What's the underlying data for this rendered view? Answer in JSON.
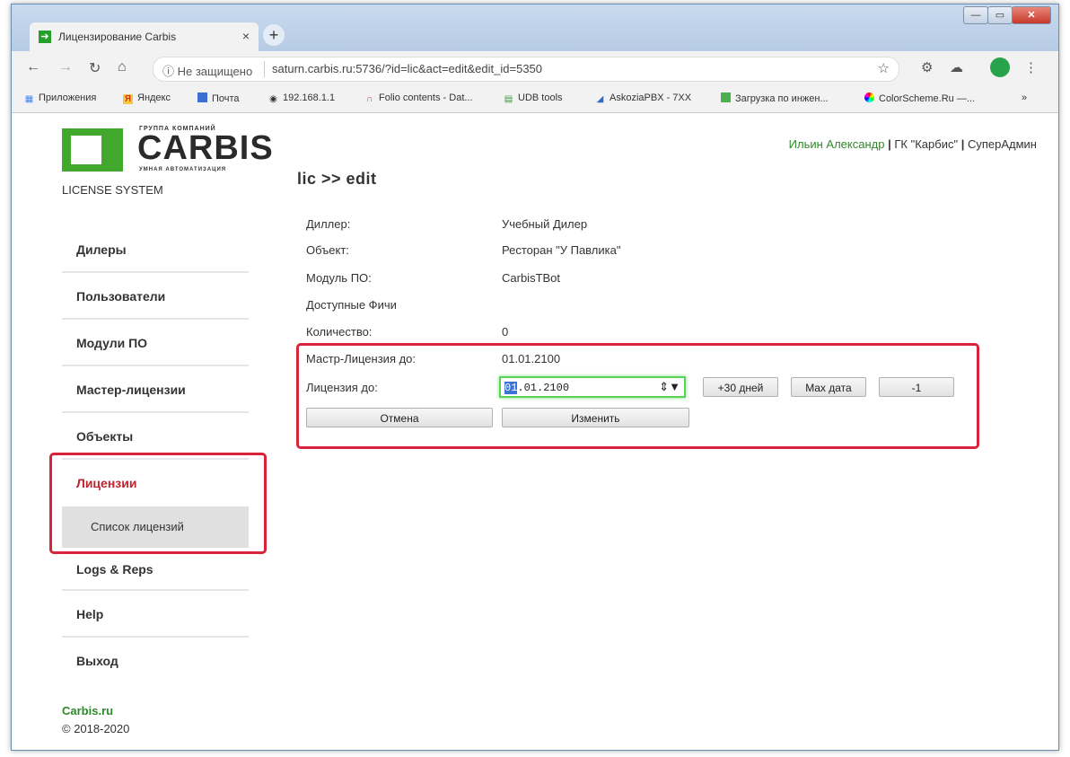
{
  "browser": {
    "tab_title": "Лицензирование Carbis",
    "tab_close": "×",
    "new_tab": "+",
    "window_buttons": [
      "—",
      "▭",
      "✕"
    ],
    "security_label": "ⓘ Не защищено",
    "url": "saturn.carbis.ru:5736/?id=lic&act=edit&edit_id=5350",
    "bookmarks": [
      "Приложения",
      "Яндекс",
      "Почта",
      "192.168.1.1",
      "Folio contents - Dat...",
      "UDB tools",
      "AskoziaPBX - 7XX",
      "Загрузка по инжен...",
      "ColorScheme.Ru —...",
      "»"
    ]
  },
  "logo": {
    "top_line": "ГРУППА КОМПАНИЙ",
    "word": "CARBIS",
    "sub_line": "УМНАЯ АВТОМАТИЗАЦИЯ",
    "system": "LICENSE SYSTEM"
  },
  "sidebar": {
    "items": [
      {
        "label": "Дилеры"
      },
      {
        "label": "Пользователи"
      },
      {
        "label": "Модули ПО"
      },
      {
        "label": "Мастер-лицензии"
      },
      {
        "label": "Объекты"
      },
      {
        "label": "Лицензии"
      },
      {
        "label": "Список лицензий"
      },
      {
        "label": "Logs & Reps"
      },
      {
        "label": "Help"
      },
      {
        "label": "Выход"
      }
    ],
    "footer_link": "Carbis.ru",
    "footer_copy": "© 2018-2020"
  },
  "user": {
    "name": "Ильин Александр",
    "sep": "|",
    "company": "ГК \"Карбис\"",
    "role": "СуперАдмин"
  },
  "main": {
    "heading": "lic >> edit",
    "fields": [
      {
        "label": "Диллер:",
        "value": "Учебный Дилер"
      },
      {
        "label": "Объект:",
        "value": "Ресторан \"У Павлика\""
      },
      {
        "label": "Модуль ПО:",
        "value": "CarbisTBot"
      },
      {
        "label": "Доступные Фичи",
        "value": ""
      },
      {
        "label": "Количество:",
        "value": "0"
      },
      {
        "label": "Мастр-Лицензия до:",
        "value": "01.01.2100"
      }
    ],
    "license_label": "Лицензия до:",
    "license_date_selected": "01",
    "license_date_rest": ".01.2100",
    "spin": "⇕▼",
    "buttons": {
      "plus30": "+30 дней",
      "max": "Max дата",
      "minus1": "-1",
      "cancel": "Отмена",
      "change": "Изменить"
    }
  },
  "colors": {
    "accent_green": "#2e8a27",
    "logo_green": "#42a82d",
    "highlight_red": "#d9233b",
    "active_menu_red": "#c0232b"
  }
}
